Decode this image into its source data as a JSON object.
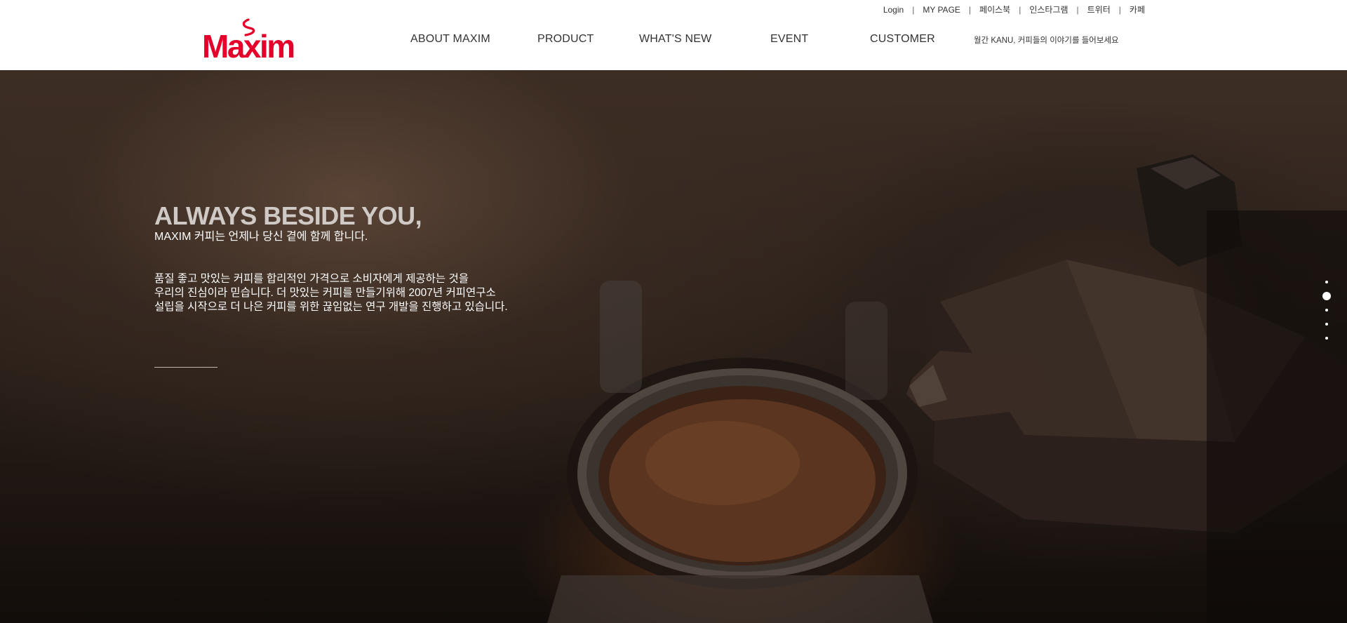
{
  "header": {
    "logo_text": "Maxim",
    "util_links": [
      "Login",
      "MY PAGE",
      "페이스북",
      "인스타그램",
      "트위터",
      "카페"
    ],
    "util_separator": "|",
    "nav": [
      "ABOUT MAXIM",
      "PRODUCT",
      "WHAT'S NEW",
      "EVENT",
      "CUSTOMER"
    ],
    "notice": "월간 KANU, 커피들의 이야기를 들어보세요"
  },
  "hero": {
    "headline": "ALWAYS BESIDE YOU,",
    "subheadline": "MAXIM 커피는 언제나 당신 곁에 함께 합니다.",
    "body_lines": [
      "품질 좋고 맛있는 커피를 합리적인 가격으로 소비자에게 제공하는 것을",
      "우리의 진심이라 믿습니다. 더 맛있는 커피를 만들기위해 2007년 커피연구소",
      "설립을 시작으로 더 나은 커피를 위한 끊임없는 연구 개발을 진행하고 있습니다."
    ]
  },
  "slider": {
    "count": 5,
    "active_index": 1
  },
  "colors": {
    "brand": "#e4002b",
    "nav_text": "#333333",
    "headline": "#cfcac6"
  }
}
